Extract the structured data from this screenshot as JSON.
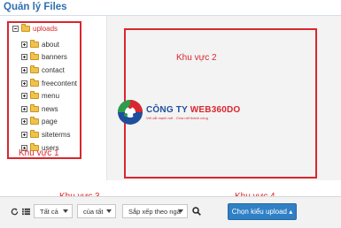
{
  "header": {
    "title": "Quản lý Files"
  },
  "tree": {
    "root": "uploads",
    "items": [
      "about",
      "banners",
      "contact",
      "freecontent",
      "menu",
      "news",
      "page",
      "siteterms",
      "users"
    ]
  },
  "regions": {
    "r1": "Khu vực 1",
    "r2": "Khu vực 2",
    "r3": "Khu vực 3",
    "r4": "Khu vực 4"
  },
  "logo": {
    "name_part1": "CÔNG TY ",
    "name_part2": "WEB360DO",
    "tagline": "Vết cắt mạnh mẽ - Chìa nết thành công"
  },
  "toolbar": {
    "filter_type": "Tất cả",
    "filter_owner": "của tất",
    "sort": "Sắp xếp theo ngà",
    "upload_label": "Chọn kiểu upload ▴"
  },
  "colors": {
    "title": "#2f6fb0",
    "region_border": "#d9272e",
    "upload_button": "#2f80c5",
    "folder": "#f0c24e"
  }
}
